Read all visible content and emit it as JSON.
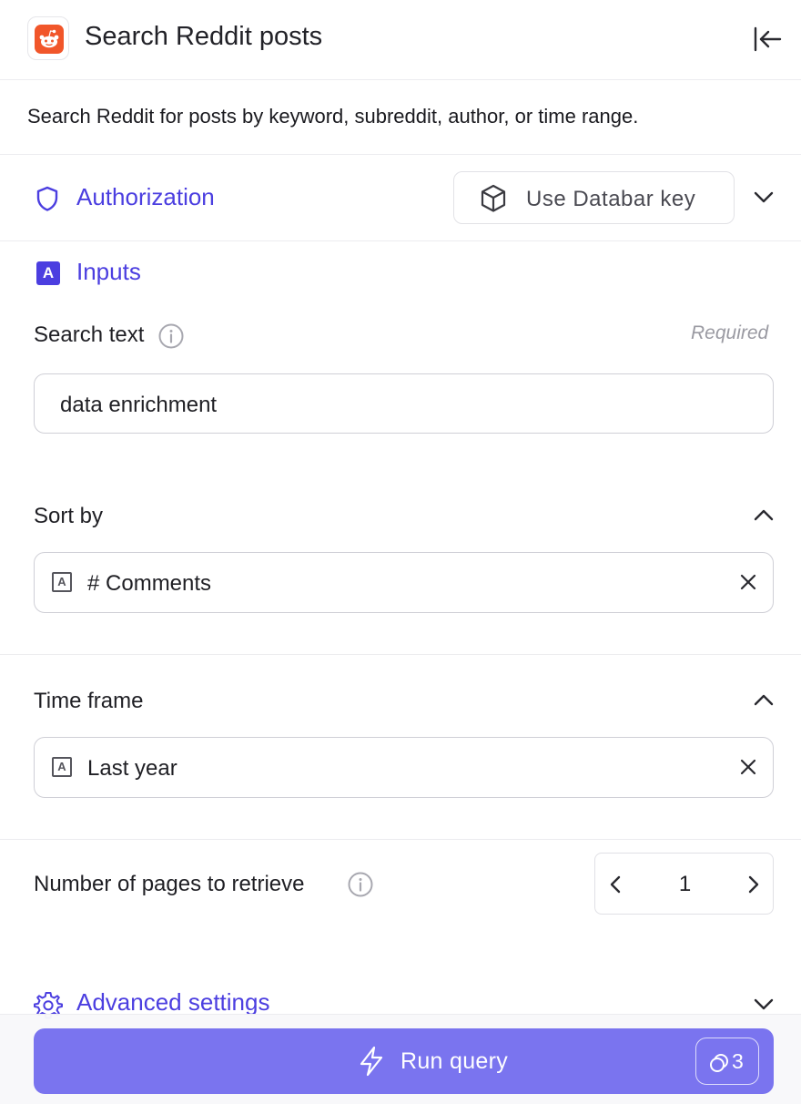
{
  "header": {
    "title": "Search Reddit posts",
    "logo_icon": "reddit-logo",
    "collapse_icon": "collapse-left-icon"
  },
  "description": "Search Reddit for posts by keyword, subreddit, author, or time range.",
  "authorization": {
    "title": "Authorization",
    "key_button_label": "Use Databar key"
  },
  "inputs": {
    "title": "Inputs",
    "search_text": {
      "label": "Search text",
      "required_label": "Required",
      "value": "data enrichment"
    },
    "sort_by": {
      "label": "Sort by",
      "value": "# Comments"
    },
    "time_frame": {
      "label": "Time frame",
      "value": "Last year"
    },
    "pages": {
      "label": "Number of pages to retrieve",
      "value": "1"
    }
  },
  "advanced": {
    "title": "Advanced settings"
  },
  "footer": {
    "run_label": "Run query",
    "credits": "3"
  },
  "colors": {
    "accent": "#4b3ee0",
    "run_button": "#7a74ef",
    "reddit": "#f1562a"
  }
}
